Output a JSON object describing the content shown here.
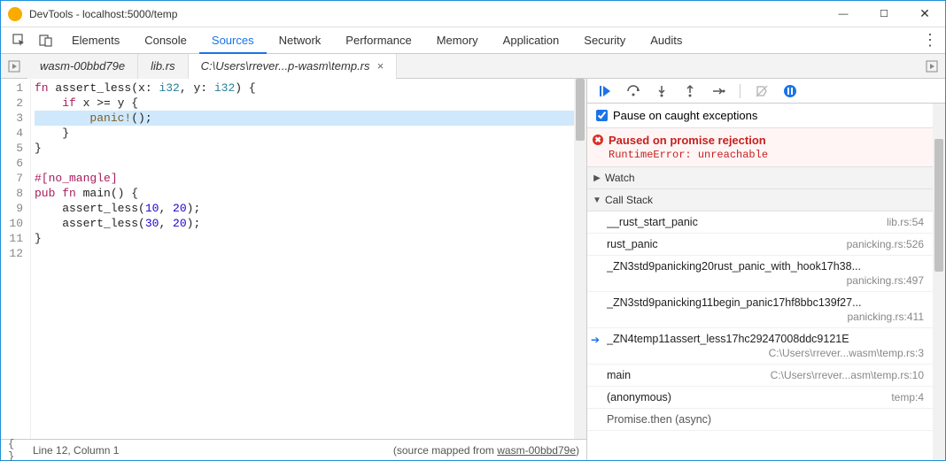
{
  "window": {
    "title": "DevTools - localhost:5000/temp"
  },
  "main_tabs": [
    "Elements",
    "Console",
    "Sources",
    "Network",
    "Performance",
    "Memory",
    "Application",
    "Security",
    "Audits"
  ],
  "active_main_tab": "Sources",
  "file_tabs": {
    "items": [
      {
        "label": "wasm-00bbd79e",
        "active": false,
        "closeable": false
      },
      {
        "label": "lib.rs",
        "active": false,
        "closeable": false
      },
      {
        "label": "C:\\Users\\rrever...p-wasm\\temp.rs",
        "active": true,
        "closeable": true
      }
    ]
  },
  "code": {
    "lines": [
      {
        "n": 1,
        "raw": "fn assert_less(x: i32, y: i32) {"
      },
      {
        "n": 2,
        "raw": "    if x >= y {"
      },
      {
        "n": 3,
        "raw": "        panic!();",
        "highlight": true
      },
      {
        "n": 4,
        "raw": "    }"
      },
      {
        "n": 5,
        "raw": "}"
      },
      {
        "n": 6,
        "raw": ""
      },
      {
        "n": 7,
        "raw": "#[no_mangle]"
      },
      {
        "n": 8,
        "raw": "pub fn main() {"
      },
      {
        "n": 9,
        "raw": "    assert_less(10, 20);"
      },
      {
        "n": 10,
        "raw": "    assert_less(30, 20);"
      },
      {
        "n": 11,
        "raw": "}"
      },
      {
        "n": 12,
        "raw": ""
      }
    ]
  },
  "status": {
    "cursor": "Line 12, Column 1",
    "mapped_prefix": "(source mapped from ",
    "mapped_link": "wasm-00bbd79e",
    "mapped_suffix": ")"
  },
  "debugger": {
    "pause_checkbox": "Pause on caught exceptions",
    "pause_title": "Paused on promise rejection",
    "pause_detail": "RuntimeError: unreachable",
    "watch_label": "Watch",
    "callstack_label": "Call Stack",
    "frames": [
      {
        "fn": "__rust_start_panic",
        "loc": "lib.rs:54"
      },
      {
        "fn": "rust_panic",
        "loc": "panicking.rs:526"
      },
      {
        "fn": "_ZN3std9panicking20rust_panic_with_hook17h38...",
        "loc": "panicking.rs:497",
        "two": true
      },
      {
        "fn": "_ZN3std9panicking11begin_panic17hf8bbc139f27...",
        "loc": "panicking.rs:411",
        "two": true
      },
      {
        "fn": "_ZN4temp11assert_less17hc29247008ddc9121E",
        "loc": "C:\\Users\\rrever...wasm\\temp.rs:3",
        "two": true,
        "current": true
      },
      {
        "fn": "main",
        "loc": "C:\\Users\\rrever...asm\\temp.rs:10"
      },
      {
        "fn": "(anonymous)",
        "loc": "temp:4"
      }
    ],
    "async_group": "Promise.then (async)"
  }
}
